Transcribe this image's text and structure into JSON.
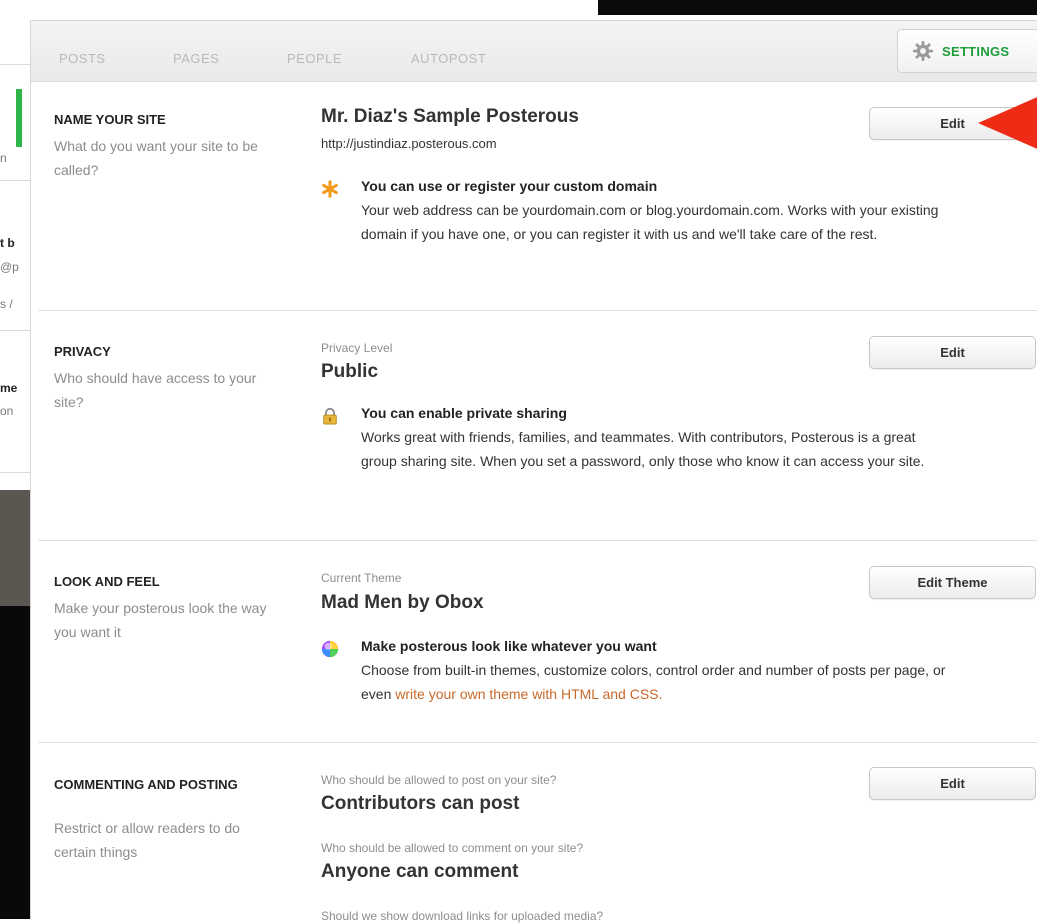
{
  "background": {
    "fragments": [
      "n",
      "t b",
      "@p",
      "s /",
      "me",
      "on"
    ]
  },
  "tabs": [
    {
      "label": "POSTS"
    },
    {
      "label": "PAGES"
    },
    {
      "label": "PEOPLE"
    },
    {
      "label": "AUTOPOST"
    }
  ],
  "settings": {
    "label": "SETTINGS",
    "icon": "gear-icon"
  },
  "sections": {
    "name": {
      "title": "NAME YOUR SITE",
      "desc": "What do you want your site to be called?",
      "value": "Mr. Diaz's Sample Posterous",
      "url": "http://justindiaz.posterous.com",
      "tip_title": "You can use or register your custom domain",
      "tip_body": "Your web address can be yourdomain.com or blog.yourdomain.com. Works with your existing domain if you have one, or you can register it with us and we'll take care of the rest.",
      "button": "Edit",
      "icon": "asterisk-icon"
    },
    "privacy": {
      "title": "PRIVACY",
      "desc": "Who should have access to your site?",
      "label": "Privacy Level",
      "value": "Public",
      "tip_title": "You can enable private sharing",
      "tip_body": "Works great with friends, families, and teammates. With contributors, Posterous is a great group sharing site. When you set a password, only those who know it can access your site.",
      "button": "Edit",
      "icon": "lock-icon"
    },
    "look": {
      "title": "LOOK AND FEEL",
      "desc": "Make your posterous look the way you want it",
      "label": "Current Theme",
      "value": "Mad Men by Obox",
      "tip_title": "Make posterous look like whatever you want",
      "tip_body_pre": "Choose from built-in themes, customize colors, control order and number of posts per page, or even ",
      "tip_link": "write your own theme with HTML and CSS.",
      "button": "Edit Theme",
      "icon": "color-wheel-icon"
    },
    "commenting": {
      "title": "COMMENTING AND POSTING",
      "desc": "Restrict or allow readers to do certain things",
      "q1": "Who should be allowed to post on your site?",
      "a1": "Contributors can post",
      "q2": "Who should be allowed to comment on your site?",
      "a2": "Anyone can comment",
      "q3": "Should we show download links for uploaded media?",
      "button": "Edit"
    }
  },
  "colors": {
    "accent_green": "#1d9e3a",
    "link_orange": "#c7692a",
    "arrow_red": "#ee2b14"
  }
}
